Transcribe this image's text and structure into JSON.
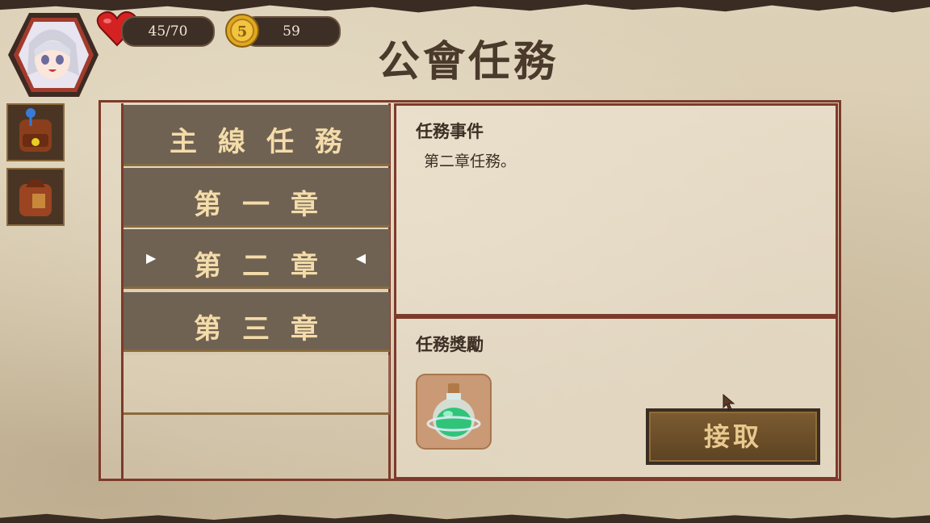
{
  "hud": {
    "hp": "45/70",
    "gold": "59",
    "hp_icon": "heart-icon",
    "gold_icon": "coin-icon"
  },
  "title": "公會任務",
  "quest_list": {
    "header": "主線任務",
    "items": [
      {
        "label": "第一章",
        "selected": false
      },
      {
        "label": "第二章",
        "selected": true
      },
      {
        "label": "第三章",
        "selected": false
      }
    ],
    "selection_markers": {
      "left": "▶",
      "right": "◀"
    }
  },
  "event_panel": {
    "label": "任務事件",
    "description": "第二章任務。"
  },
  "reward_panel": {
    "label": "任務獎勵",
    "reward_icon": "green-potion-icon"
  },
  "accept_button": "接取",
  "colors": {
    "border": "#7d3a2a",
    "row": "#6f6253",
    "row_text": "#f4dcaa",
    "button": "#5e4424"
  }
}
